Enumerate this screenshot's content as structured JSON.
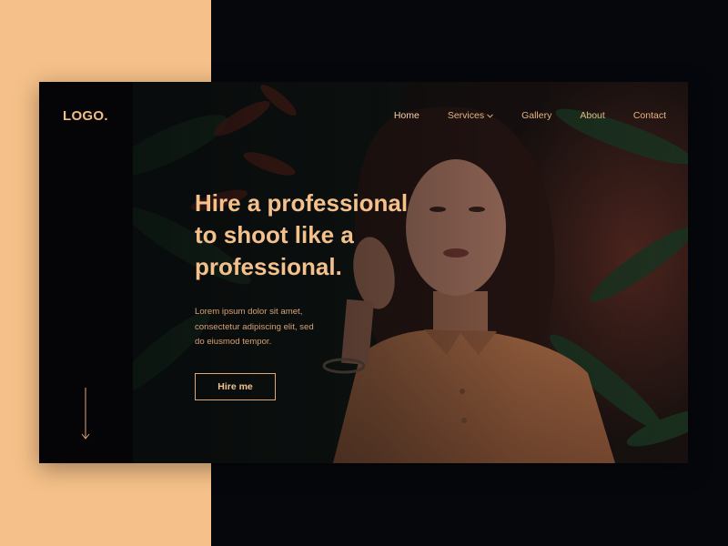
{
  "brand": {
    "logo": "LOGO."
  },
  "nav": {
    "items": [
      {
        "label": "Home",
        "active": true
      },
      {
        "label": "Services",
        "has_dropdown": true
      },
      {
        "label": "Gallery"
      },
      {
        "label": "About"
      },
      {
        "label": "Contact"
      }
    ]
  },
  "hero": {
    "headline": [
      "Hire a professional",
      "to shoot like a",
      "professional."
    ],
    "subtext": [
      "Lorem ipsum dolor sit amet,",
      "consectetur adipiscing elit, sed",
      "do eiusmod tempor."
    ],
    "cta_label": "Hire me"
  },
  "icons": {
    "scroll": "arrow-down-icon",
    "dropdown": "chevron-down-icon"
  },
  "colors": {
    "accent": "#f5c089",
    "background": "#05070c",
    "text_accent": "#f4c08c",
    "sidebar": "#050507"
  }
}
